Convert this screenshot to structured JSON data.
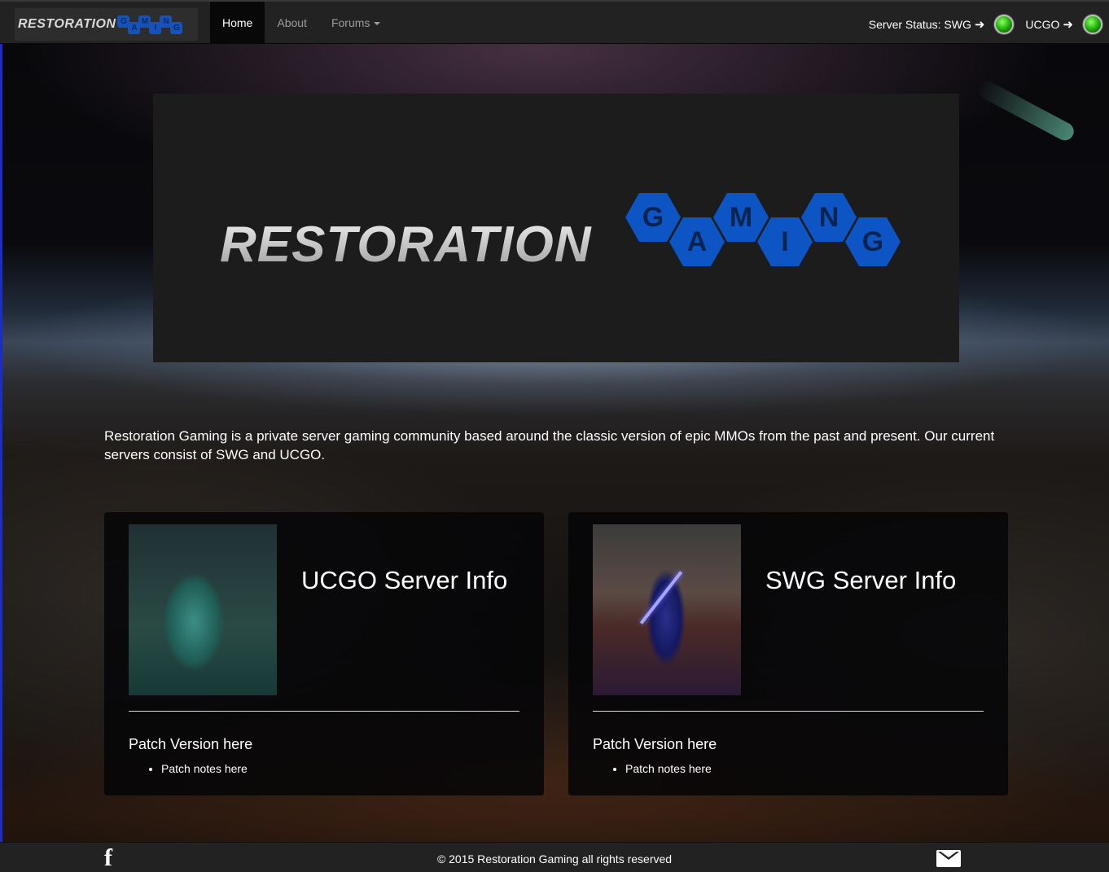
{
  "navbar": {
    "brand": {
      "word": "RESTORATION",
      "letters": [
        "G",
        "A",
        "M",
        "I",
        "N",
        "G"
      ]
    },
    "items": [
      {
        "label": "Home",
        "active": true
      },
      {
        "label": "About",
        "active": false
      },
      {
        "label": "Forums",
        "active": false,
        "dropdown": true
      }
    ],
    "status": {
      "label": "Server Status: SWG",
      "ucgo_label": "UCGO",
      "arrow_icon": "arrow-right-icon",
      "swg_state": "online",
      "ucgo_state": "online",
      "online_color": "#27b80e"
    }
  },
  "hero": {
    "word": "RESTORATION",
    "letters": [
      "G",
      "A",
      "M",
      "I",
      "N",
      "G"
    ],
    "accent_color": "#0d55c4"
  },
  "intro": "Restoration Gaming is a private server gaming community based around the classic version of epic MMOs from the past and present. Our current servers consist of SWG and UCGO.",
  "panels": [
    {
      "title": "UCGO Server Info",
      "patch_version": "Patch Version here",
      "notes": [
        "Patch notes here"
      ]
    },
    {
      "title": "SWG Server Info",
      "patch_version": "Patch Version here",
      "notes": [
        "Patch notes here"
      ]
    }
  ],
  "footer": {
    "copyright": "© 2015 Restoration Gaming all rights reserved",
    "facebook_icon": "facebook-icon",
    "mail_icon": "envelope-icon"
  }
}
